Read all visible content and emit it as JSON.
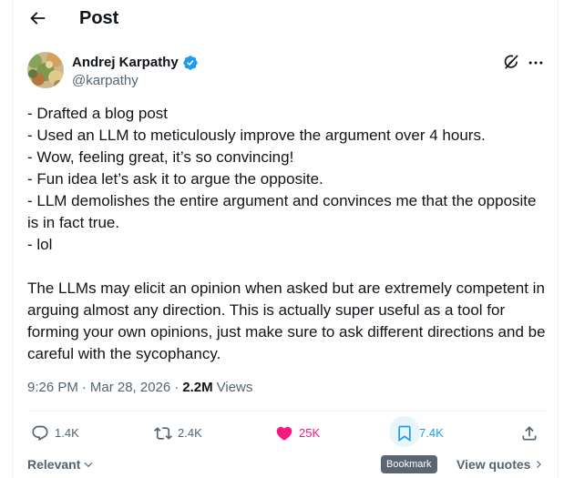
{
  "header": {
    "title": "Post",
    "back_icon": "arrow-left-icon"
  },
  "author": {
    "name": "Andrej Karpathy",
    "handle": "@karpathy",
    "verified": true,
    "verified_color": "#1d9bf0"
  },
  "post": {
    "paragraph1": "- Drafted a blog post\n- Used an LLM to meticulously improve the argument over 4 hours.\n- Wow, feeling great, it’s so convincing!\n- Fun idea let’s ask it to argue the opposite.\n- LLM demolishes the entire argument and convinces me that the opposite is in fact true.\n- lol",
    "paragraph2": "The LLMs may elicit an opinion when asked but are extremely competent in arguing almost any direction. This is actually super useful as a tool for forming your own opinions, just make sure to ask different directions and be careful with the sycophancy."
  },
  "meta": {
    "time": "9:26 PM",
    "separator": "·",
    "date": "Mar 28, 2026",
    "views_count": "2.2M",
    "views_label": "Views"
  },
  "actions": {
    "replies": "1.4K",
    "reposts": "2.4K",
    "likes": "25K",
    "bookmarks": "7.4K",
    "like_color": "#f91880",
    "bookmark_color": "#1d9bf0"
  },
  "tooltip": {
    "bookmark": "Bookmark"
  },
  "footer": {
    "sort_label": "Relevant",
    "view_quotes_label": "View quotes"
  }
}
